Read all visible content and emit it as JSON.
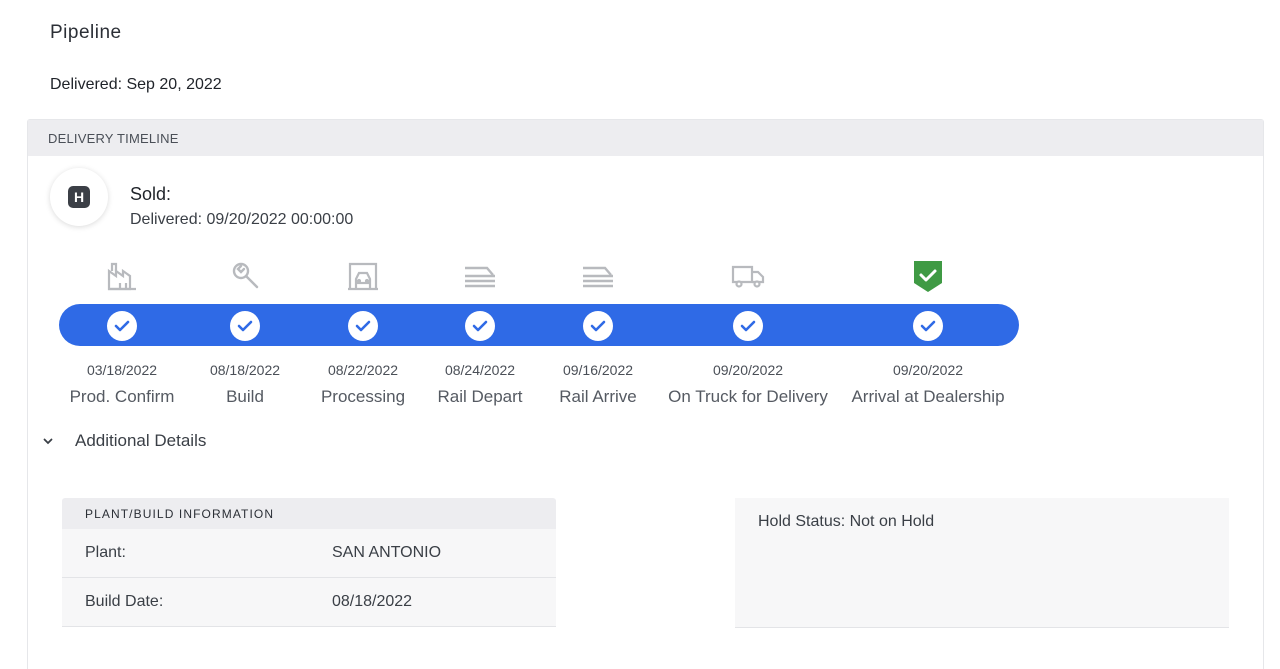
{
  "page": {
    "title": "Pipeline",
    "delivered_summary": "Delivered: Sep 20, 2022"
  },
  "timeline_card": {
    "header": "DELIVERY TIMELINE",
    "status": {
      "avatar_letter": "H",
      "title": "Sold:",
      "subtitle": "Delivered: 09/20/2022 00:00:00"
    },
    "stages": [
      {
        "date": "03/18/2022",
        "label": "Prod. Confirm",
        "icon": "factory-icon",
        "complete": true
      },
      {
        "date": "08/18/2022",
        "label": "Build",
        "icon": "wrench-icon",
        "complete": true
      },
      {
        "date": "08/22/2022",
        "label": "Processing",
        "icon": "car-bay-icon",
        "complete": true
      },
      {
        "date": "08/24/2022",
        "label": "Rail Depart",
        "icon": "rail-icon",
        "complete": true
      },
      {
        "date": "09/16/2022",
        "label": "Rail Arrive",
        "icon": "rail-icon",
        "complete": true
      },
      {
        "date": "09/20/2022",
        "label": "On Truck for Delivery",
        "icon": "truck-icon",
        "complete": true
      },
      {
        "date": "09/20/2022",
        "label": "Arrival at Dealership",
        "icon": "shield-check-icon",
        "complete": true
      }
    ],
    "colors": {
      "bar": "#2f6ae6",
      "stage_icon": "#b8babe",
      "dealership_icon": "#3f9a44"
    }
  },
  "details": {
    "toggle_label": "Additional Details",
    "plant_box": {
      "header": "PLANT/BUILD INFORMATION",
      "rows": [
        {
          "label": "Plant:",
          "value": "SAN ANTONIO"
        },
        {
          "label": "Build Date:",
          "value": "08/18/2022"
        }
      ]
    },
    "hold_status": "Hold Status: Not on Hold"
  }
}
